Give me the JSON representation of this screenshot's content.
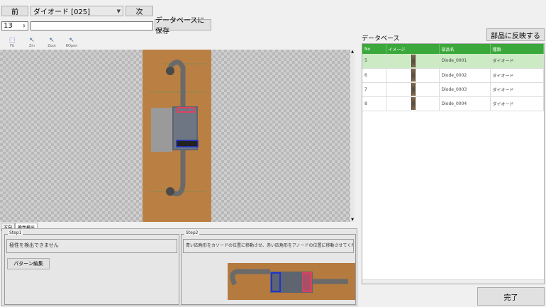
{
  "nav": {
    "prev_label": "前",
    "next_label": "次",
    "part_select": "ダイオード [025]"
  },
  "toolbar": {
    "number_value": "13",
    "name_value": "",
    "save_label": "データベースに保存",
    "tools": [
      {
        "name": "select-icon",
        "glyph": "⬚",
        "label": "Fit"
      },
      {
        "name": "zoom-in-icon",
        "glyph": "↖",
        "label": "Zin"
      },
      {
        "name": "zoom-out-icon",
        "glyph": "↖",
        "label": "Zout"
      },
      {
        "name": "rotate-icon",
        "glyph": "↖",
        "label": "ROpen"
      }
    ]
  },
  "viewer_tabs": [
    "方向",
    "極性検出"
  ],
  "step1": {
    "title": "Step1",
    "message": "極性を検出できません",
    "pattern_button": "パターン編集"
  },
  "step2": {
    "title": "Step2",
    "message": "青い四角形をカソードの位置に移動させ、赤い四角形をアノードの位置に移動させてください"
  },
  "database": {
    "title": "データベース",
    "apply_button": "部品に反映する",
    "columns": [
      "No",
      "イメージ",
      "部品名",
      "種類"
    ],
    "rows": [
      {
        "no": "5",
        "name": "Diode_0001",
        "type": "ダイオード",
        "selected": true
      },
      {
        "no": "6",
        "name": "Diode_0002",
        "type": "ダイオード",
        "selected": false
      },
      {
        "no": "7",
        "name": "Diode_0003",
        "type": "ダイオード",
        "selected": false
      },
      {
        "no": "8",
        "name": "Diode_0004",
        "type": "ダイオード",
        "selected": false
      }
    ]
  },
  "finish_button": "完了",
  "colors": {
    "header_green": "#3aa83a",
    "selected_row": "#ccebc4",
    "cathode_marker": "#2233cc",
    "anode_marker": "#e04060"
  }
}
